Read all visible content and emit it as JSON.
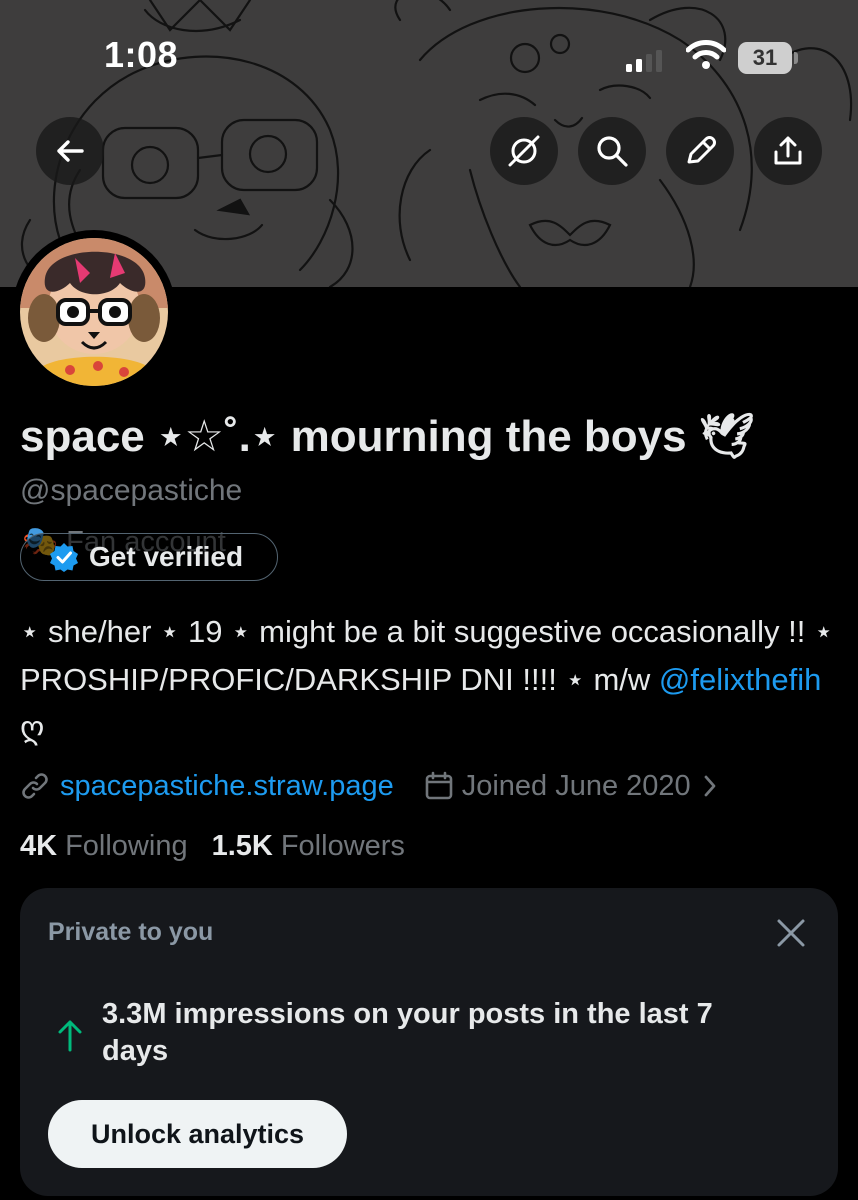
{
  "status_bar": {
    "time": "1:08",
    "battery_level": "31"
  },
  "header": {
    "back_icon": "arrow-left-icon",
    "actions": [
      "grok-icon",
      "search-icon",
      "pen-icon",
      "share-icon"
    ]
  },
  "profile": {
    "display_name": "space ⋆☆˚.⋆ mourning the boys 🕊",
    "handle": "@spacepastiche",
    "category_label": "🎭 Fan account",
    "verified_pill_label": "Get verified",
    "bio_text": "⋆ she/her ⋆ 19 ⋆ might be a bit suggestive occasionally !! ⋆ PROSHIP/PROFIC/DARKSHIP DNI !!!! ⋆ m/w ",
    "bio_mention": "@felixthefih",
    "bio_suffix": " ღ",
    "website": "spacepastiche.straw.page",
    "joined": "Joined June 2020",
    "following_count": "4K",
    "following_label": "Following",
    "followers_count": "1.5K",
    "followers_label": "Followers"
  },
  "analytics_card": {
    "title": "Private to you",
    "message": "3.3M impressions on your posts in the last 7 days",
    "button_label": "Unlock analytics"
  },
  "colors": {
    "accent": "#1d9bf0",
    "secondary_text": "#71767b",
    "trend_up": "#00ba7c",
    "card_bg": "#16181c"
  }
}
